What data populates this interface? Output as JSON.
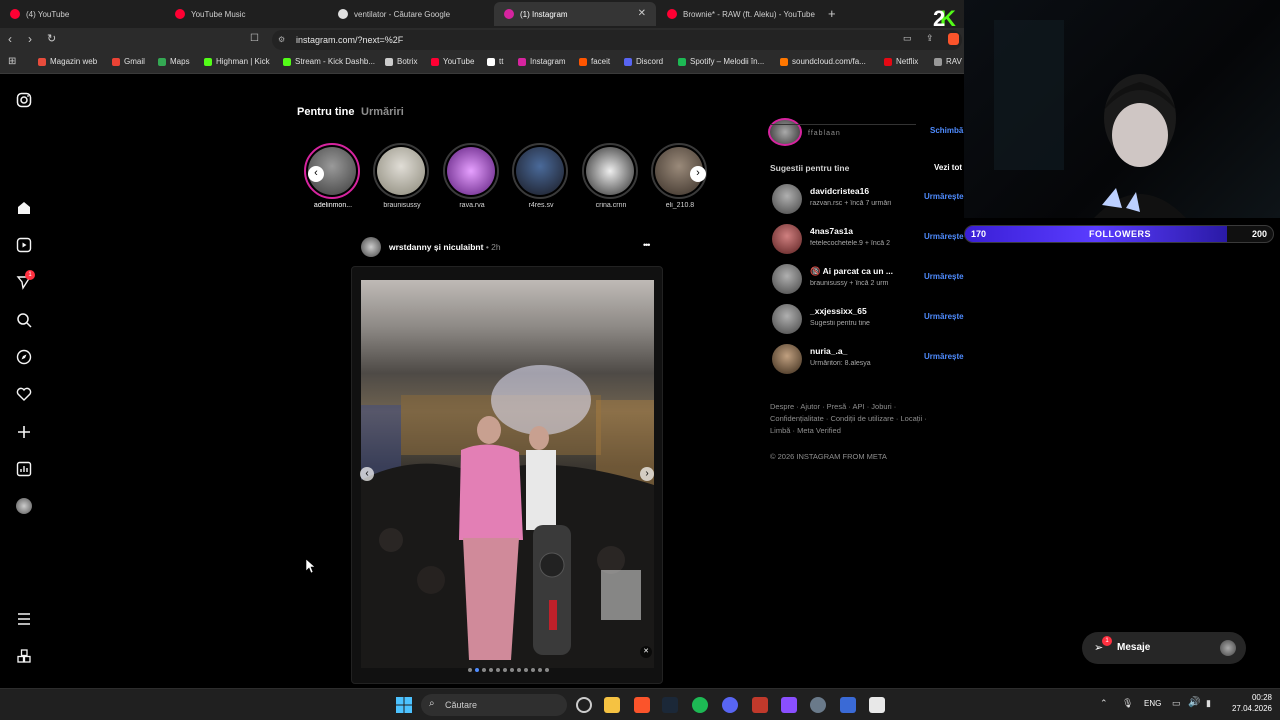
{
  "tabs": [
    {
      "label": "(4) YouTube",
      "color": "#ff0033"
    },
    {
      "label": "YouTube Music",
      "color": "#ff0033"
    },
    {
      "label": "ventilator - Căutare Google",
      "color": "#e0e0e0"
    },
    {
      "label": "(1) Instagram",
      "color": "#d6249f"
    },
    {
      "label": "Brownie* - RAW (ft. Aleku) - YouTube",
      "color": "#ff0033"
    }
  ],
  "new_tab": "+",
  "url": "instagram.com/?next=%2F",
  "bookmarks": [
    {
      "label": "Magazin web",
      "color": "#e74c3c"
    },
    {
      "label": "Gmail",
      "color": "#ea4335"
    },
    {
      "label": "Maps",
      "color": "#34a853"
    },
    {
      "label": "Highman | Kick",
      "color": "#53fc18"
    },
    {
      "label": "Stream - Kick Dashb...",
      "color": "#53fc18"
    },
    {
      "label": "Botrix",
      "color": "#cccccc"
    },
    {
      "label": "YouTube",
      "color": "#ff0033"
    },
    {
      "label": "tt",
      "color": "#ffffff"
    },
    {
      "label": "Instagram",
      "color": "#d6249f"
    },
    {
      "label": "faceit",
      "color": "#ff5500"
    },
    {
      "label": "Discord",
      "color": "#5865f2"
    },
    {
      "label": "Spotify – Melodii în...",
      "color": "#1db954"
    },
    {
      "label": "soundcloud.com/fa...",
      "color": "#ff7700"
    },
    {
      "label": "Netflix",
      "color": "#e50914"
    },
    {
      "label": "RAV",
      "color": "#999999"
    }
  ],
  "feed_tabs": {
    "for_you": "Pentru tine",
    "following": "Urmăriri"
  },
  "stories": [
    {
      "name": "adelinmon...",
      "seen": false
    },
    {
      "name": "braunisussy",
      "seen": true
    },
    {
      "name": "rava.rva",
      "seen": true
    },
    {
      "name": "r4res.sv",
      "seen": true
    },
    {
      "name": "crina.crnn",
      "seen": true
    },
    {
      "name": "eli_210.8",
      "seen": true
    }
  ],
  "post": {
    "authors": "wrstdanny și niculaibnt",
    "time": "• 2h",
    "more": "•••",
    "slides": 12,
    "current_slide": 2
  },
  "notification_badge": "1",
  "profile": {
    "sub": "ffablaan",
    "switch": "Schimbă"
  },
  "suggestions_header": {
    "title": "Sugestii pentru tine",
    "see_all": "Vezi tot"
  },
  "suggestions": [
    {
      "user": "davidcristea16",
      "sub": "razvan.rsc + încă 7 urmări",
      "action": "Urmărește"
    },
    {
      "user": "4nas7as1a",
      "sub": "fetelecochetele.9 + încă 2",
      "action": "Urmărește"
    },
    {
      "user": "🔞 Ai parcat ca un ...",
      "sub": "braunisussy + încă 2 urm",
      "action": "Urmărește"
    },
    {
      "user": "_xxjessixx_65",
      "sub": "Sugestii pentru tine",
      "action": "Urmărește"
    },
    {
      "user": "nuria_.a_",
      "sub": "Urmăritori: 8.alesya",
      "action": "Urmărește"
    }
  ],
  "footer": {
    "line1": "Despre · Ajutor · Presă · API · Joburi ·",
    "line2": "Confidențialitate · Condiții de utilizare · Locații ·",
    "line3": "Limbă · Meta Verified",
    "copyright": "© 2026 INSTAGRAM FROM META"
  },
  "messages": {
    "label": "Mesaje",
    "badge": "1"
  },
  "overlay": {
    "kick_digit": "2",
    "followers_label": "FOLLOWERS",
    "current": "170",
    "goal": "200",
    "progress": 0.85
  },
  "taskbar": {
    "search": "Căutare",
    "lang": "ENG",
    "time": "00:28",
    "date": "27.04.2026"
  }
}
